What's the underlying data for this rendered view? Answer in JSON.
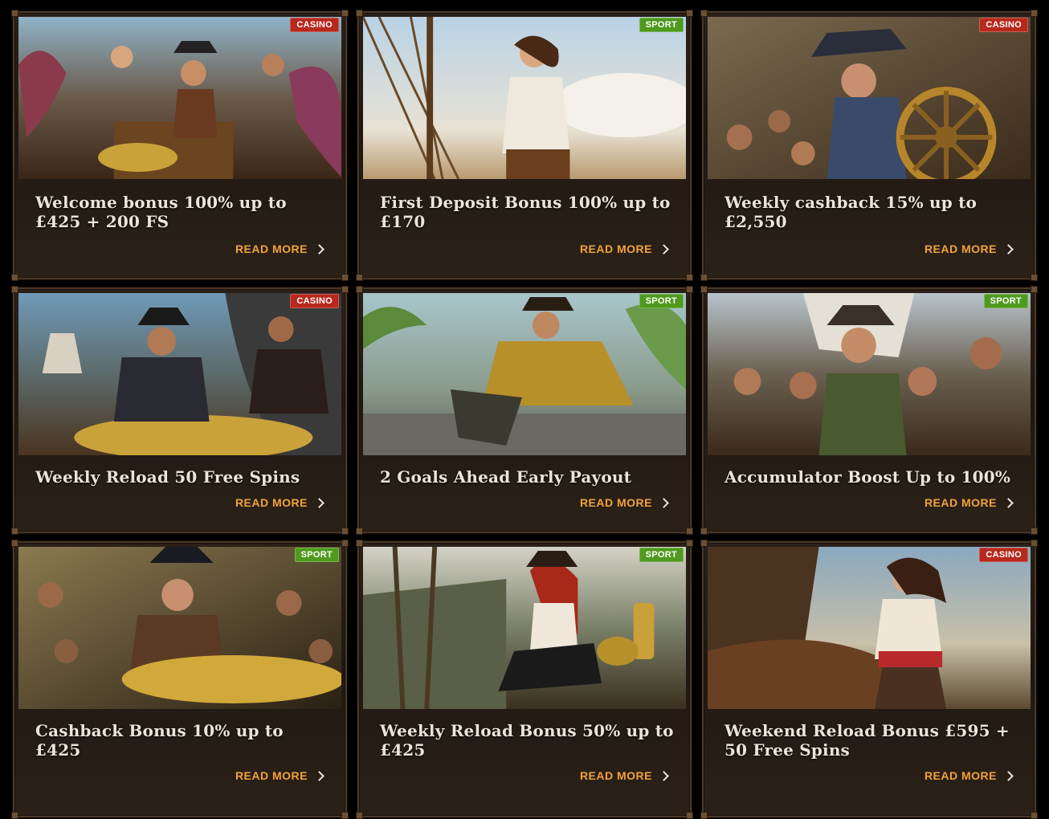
{
  "colors": {
    "casino_badge": "#b8281c",
    "sport_badge": "#4f9a1e",
    "read_more": "#f2a33a",
    "title": "#ece4d8"
  },
  "read_more_label": "READ MORE",
  "cards": [
    {
      "badge": "CASINO",
      "title": "Welcome bonus 100% up to £425 + 200 FS",
      "image": "pirate-crew-treasure-octopus"
    },
    {
      "badge": "SPORT",
      "title": "First Deposit Bonus 100% up to £170",
      "image": "pirate-woman-ship-deck"
    },
    {
      "badge": "CASINO",
      "title": "Weekly cashback 15% up to £2,550",
      "image": "pirate-captain-ship-wheel"
    },
    {
      "badge": "CASINO",
      "title": "Weekly Reload 50 Free Spins",
      "image": "pirates-gold-coins-beach"
    },
    {
      "badge": "SPORT",
      "title": "2 Goals Ahead Early Payout",
      "image": "pirate-lounging-dock"
    },
    {
      "badge": "SPORT",
      "title": "Accumulator Boost Up to 100%",
      "image": "pirate-crew-portrait"
    },
    {
      "badge": "SPORT",
      "title": "Cashback Bonus 10% up to £425",
      "image": "pirate-counting-gold"
    },
    {
      "badge": "SPORT",
      "title": "Weekly Reload Bonus 50% up to £425",
      "image": "pirate-woman-rum-bottle"
    },
    {
      "badge": "CASINO",
      "title": "Weekend Reload Bonus £595 + 50 Free Spins",
      "image": "pirate-woman-ship-bow"
    }
  ]
}
